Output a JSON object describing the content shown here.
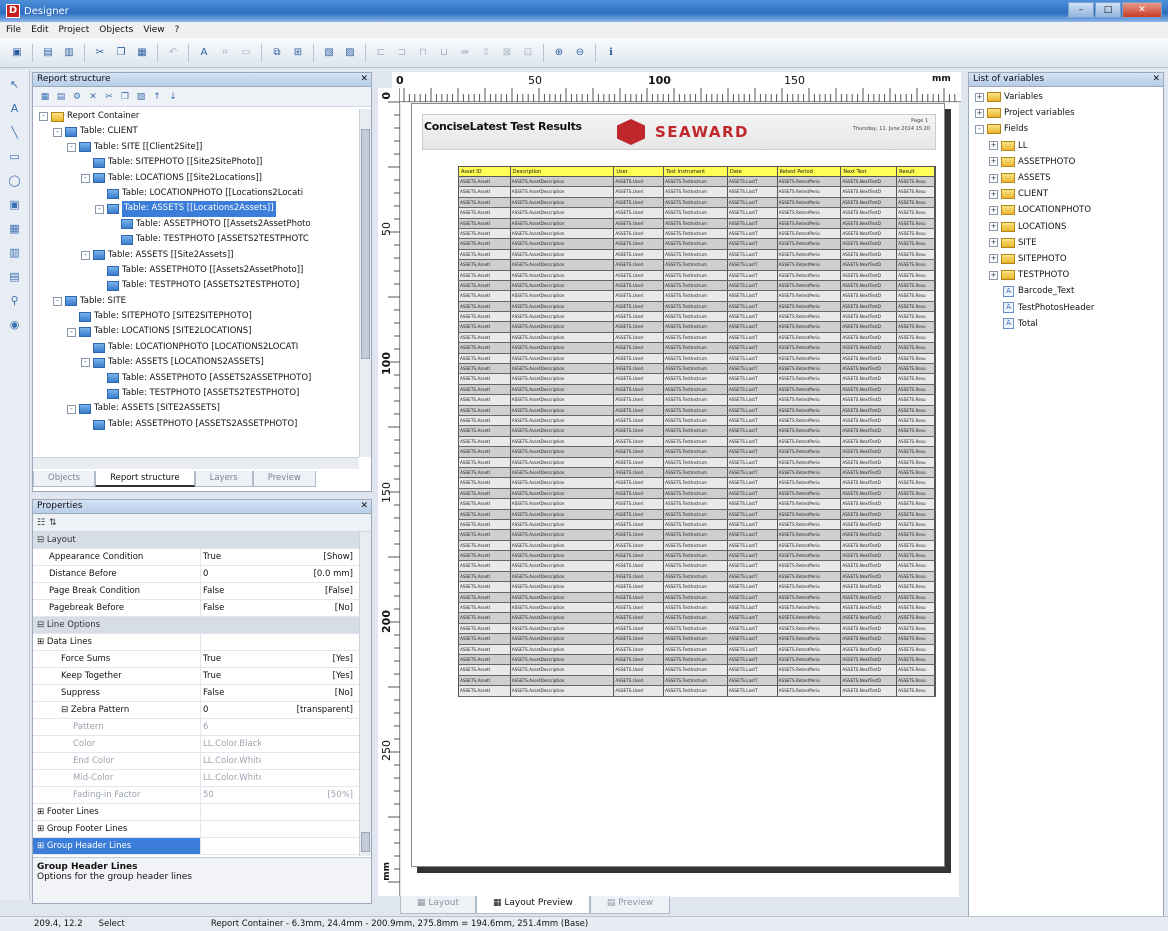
{
  "window": {
    "title": "Designer",
    "app_letter": "D"
  },
  "menu": [
    "File",
    "Edit",
    "Project",
    "Objects",
    "View",
    "?"
  ],
  "report_structure": {
    "title": "Report structure",
    "tree": [
      {
        "l": "Report Container",
        "d": 0,
        "t": "-",
        "i": "folder"
      },
      {
        "l": "Table: CLIENT",
        "d": 1,
        "t": "-",
        "i": "table"
      },
      {
        "l": "Table: SITE [[Client2Site]]",
        "d": 2,
        "t": "-",
        "i": "table"
      },
      {
        "l": "Table: SITEPHOTO [[Site2SitePhoto]]",
        "d": 3,
        "t": "",
        "i": "table"
      },
      {
        "l": "Table: LOCATIONS [[Site2Locations]]",
        "d": 3,
        "t": "-",
        "i": "table"
      },
      {
        "l": "Table: LOCATIONPHOTO [[Locations2Locati",
        "d": 4,
        "t": "",
        "i": "table"
      },
      {
        "l": "Table: ASSETS [[Locations2Assets]]",
        "d": 4,
        "t": "-",
        "i": "table",
        "sel": true
      },
      {
        "l": "Table: ASSETPHOTO [[Assets2AssetPhoto",
        "d": 5,
        "t": "",
        "i": "table"
      },
      {
        "l": "Table: TESTPHOTO [ASSETS2TESTPHOTC",
        "d": 5,
        "t": "",
        "i": "table"
      },
      {
        "l": "Table: ASSETS [[Site2Assets]]",
        "d": 3,
        "t": "-",
        "i": "table"
      },
      {
        "l": "Table: ASSETPHOTO [[Assets2AssetPhoto]]",
        "d": 4,
        "t": "",
        "i": "table"
      },
      {
        "l": "Table: TESTPHOTO [ASSETS2TESTPHOTO]",
        "d": 4,
        "t": "",
        "i": "table"
      },
      {
        "l": "Table: SITE",
        "d": 1,
        "t": "-",
        "i": "table"
      },
      {
        "l": "Table: SITEPHOTO [SITE2SITEPHOTO]",
        "d": 2,
        "t": "",
        "i": "table"
      },
      {
        "l": "Table: LOCATIONS [SITE2LOCATIONS]",
        "d": 2,
        "t": "-",
        "i": "table"
      },
      {
        "l": "Table: LOCATIONPHOTO [LOCATIONS2LOCATI",
        "d": 3,
        "t": "",
        "i": "table"
      },
      {
        "l": "Table: ASSETS [LOCATIONS2ASSETS]",
        "d": 3,
        "t": "-",
        "i": "table"
      },
      {
        "l": "Table: ASSETPHOTO [ASSETS2ASSETPHOTO]",
        "d": 4,
        "t": "",
        "i": "table"
      },
      {
        "l": "Table: TESTPHOTO [ASSETS2TESTPHOTO]",
        "d": 4,
        "t": "",
        "i": "table"
      },
      {
        "l": "Table: ASSETS [SITE2ASSETS]",
        "d": 2,
        "t": "-",
        "i": "table"
      },
      {
        "l": "Table: ASSETPHOTO [ASSETS2ASSETPHOTO]",
        "d": 3,
        "t": "",
        "i": "table"
      }
    ],
    "tabs": [
      "Objects",
      "Report structure",
      "Layers",
      "Preview"
    ]
  },
  "properties": {
    "title": "Properties",
    "rows": [
      {
        "n": "Layout",
        "c": "cat"
      },
      {
        "n": "Appearance Condition",
        "v": "True",
        "x": "[Show]"
      },
      {
        "n": "Distance Before",
        "v": "0",
        "x": "[0.0 mm]"
      },
      {
        "n": "Page Break Condition",
        "v": "False",
        "x": "[False]"
      },
      {
        "n": "Pagebreak Before",
        "v": "False",
        "x": "[No]"
      },
      {
        "n": "Line Options",
        "c": "cat"
      },
      {
        "n": "Data Lines",
        "c": "grp"
      },
      {
        "n": "Force Sums",
        "v": "True",
        "x": "[Yes]",
        "c": "lvl2"
      },
      {
        "n": "Keep Together",
        "v": "True",
        "x": "[Yes]",
        "c": "lvl2"
      },
      {
        "n": "Suppress",
        "v": "False",
        "x": "[No]",
        "c": "lvl2"
      },
      {
        "n": "Zebra Pattern",
        "v": "0",
        "x": "[transparent]",
        "c": "lvl2"
      },
      {
        "n": "Pattern",
        "v": "6",
        "x": "",
        "c": "lvl3 dim"
      },
      {
        "n": "Color",
        "v": "LL.Color.Black",
        "x": "",
        "c": "lvl3 dim"
      },
      {
        "n": "End Color",
        "v": "LL.Color.White",
        "x": "",
        "c": "lvl3 dim"
      },
      {
        "n": "Mid-Color",
        "v": "LL.Color.White",
        "x": "",
        "c": "lvl3 dim"
      },
      {
        "n": "Fading-in Factor",
        "v": "50",
        "x": "[50%]",
        "c": "lvl3 dim"
      },
      {
        "n": "Footer Lines",
        "c": "grp"
      },
      {
        "n": "Group Footer Lines",
        "c": "grp"
      },
      {
        "n": "Group Header Lines",
        "c": "grp sel"
      }
    ],
    "desc_title": "Group Header Lines",
    "desc_text": "Options for the group header lines"
  },
  "ruler": {
    "h": [
      "0",
      "50",
      "100",
      "150",
      "mm"
    ],
    "v": [
      "0",
      "50",
      "100",
      "150",
      "200",
      "250",
      "mm"
    ]
  },
  "report": {
    "title": "ConciseLatest Test Results",
    "brand": "SEAWARD",
    "date": "Thursday, 11. June 2014 15:20",
    "page": "Page 1",
    "columns": [
      "Asset ID",
      "Description",
      "User",
      "Test Instrument",
      "Date",
      "Retest Period",
      "Next Test",
      "Result"
    ],
    "cell_text": [
      "ASSETS.AssetI",
      "ASSETS.AssetDescription",
      "ASSETS.UserI",
      "ASSETS.TestInstrum",
      "ASSETS.LastT",
      "ASSETS.RetestPerio",
      "ASSETS.NextTestD",
      "ASSETS.Resu"
    ]
  },
  "bottom_tabs": [
    "Layout",
    "Layout Preview",
    "Preview"
  ],
  "variables": {
    "title": "List of variables",
    "items": [
      {
        "l": "Variables",
        "d": 0,
        "t": "+",
        "i": "folder"
      },
      {
        "l": "Project variables",
        "d": 0,
        "t": "+",
        "i": "folder"
      },
      {
        "l": "Fields",
        "d": 0,
        "t": "-",
        "i": "folder"
      },
      {
        "l": "LL",
        "d": 1,
        "t": "+",
        "i": "folder"
      },
      {
        "l": "ASSETPHOTO",
        "d": 1,
        "t": "+",
        "i": "folder"
      },
      {
        "l": "ASSETS",
        "d": 1,
        "t": "+",
        "i": "folder"
      },
      {
        "l": "CLIENT",
        "d": 1,
        "t": "+",
        "i": "folder"
      },
      {
        "l": "LOCATIONPHOTO",
        "d": 1,
        "t": "+",
        "i": "folder"
      },
      {
        "l": "LOCATIONS",
        "d": 1,
        "t": "+",
        "i": "folder"
      },
      {
        "l": "SITE",
        "d": 1,
        "t": "+",
        "i": "folder"
      },
      {
        "l": "SITEPHOTO",
        "d": 1,
        "t": "+",
        "i": "folder"
      },
      {
        "l": "TESTPHOTO",
        "d": 1,
        "t": "+",
        "i": "folder"
      },
      {
        "l": "Barcode_Text",
        "d": 1,
        "t": "",
        "i": "var"
      },
      {
        "l": "TestPhotosHeader",
        "d": 1,
        "t": "",
        "i": "var"
      },
      {
        "l": "Total",
        "d": 1,
        "t": "",
        "i": "var"
      }
    ]
  },
  "status": {
    "coords": "209.4, 12.2",
    "mode": "Select",
    "info": "Report Container - 6.3mm, 24.4mm - 200.9mm, 275.8mm = 194.6mm, 251.4mm (Base)"
  }
}
